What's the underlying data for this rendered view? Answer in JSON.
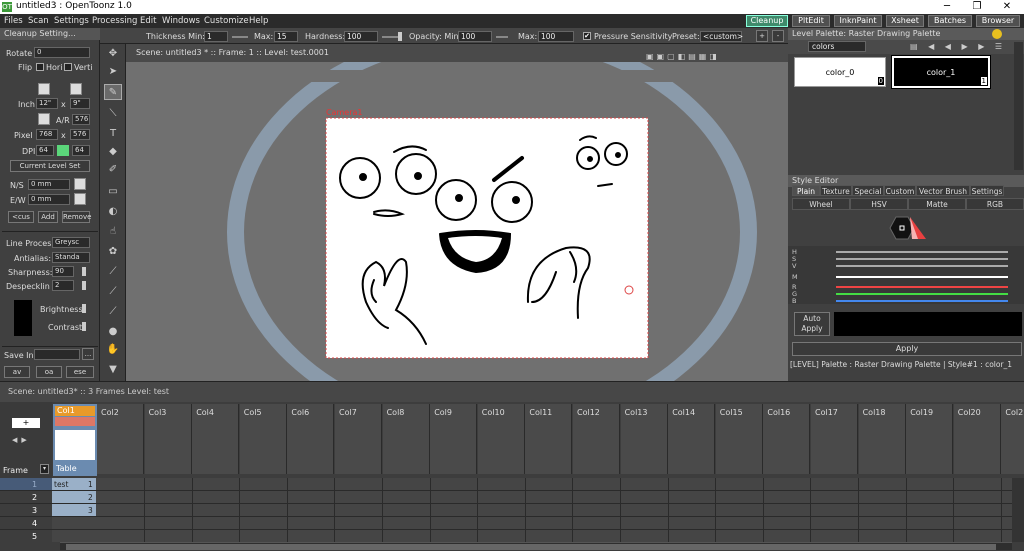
{
  "window": {
    "title": "untitled3 : OpenToonz 1.0",
    "app_icon": "OT"
  },
  "menu": [
    "Files",
    "Scan",
    "Settings",
    "Processing",
    "Edit",
    "Windows",
    "Customize",
    "Help"
  ],
  "rooms": [
    {
      "label": "Cleanup",
      "active": true
    },
    {
      "label": "PltEdit",
      "active": false
    },
    {
      "label": "InknPaint",
      "active": false
    },
    {
      "label": "Xsheet",
      "active": false
    },
    {
      "label": "Batches",
      "active": false
    },
    {
      "label": "Browser",
      "active": false
    }
  ],
  "tool_options": {
    "thickness_min_label": "Thickness Min:",
    "thickness_min": "1",
    "max_label": "Max:",
    "thickness_max": "15",
    "hardness_label": "Hardness:",
    "hardness": "100",
    "opacity_min_label": "Opacity: Min:",
    "opacity_min": "100",
    "opacity_max_label": "Max:",
    "opacity_max": "100",
    "pressure_label": "Pressure Sensitivity",
    "pressure_check": "✔",
    "preset_label": "Preset:",
    "preset": "<custom>",
    "add_preset": "+",
    "remove_preset": "-"
  },
  "cleanup": {
    "header": "Cleanup Setting...",
    "rotate_label": "Rotate",
    "rotate": "0",
    "flip_label": "Flip",
    "hori_label": "Hori",
    "verti_label": "Verti",
    "inch_label": "Inch",
    "inch_w": "12\"",
    "inch_h": "9\"",
    "x1": "x",
    "ar_label": "A/R",
    "ar": "576",
    "pixel_label": "Pixel",
    "pixel_w": "768",
    "pixel_h": "576",
    "x2": "x",
    "dpi_label": "DPI",
    "dpi1": "64",
    "dpi2": "64",
    "current_level": "Current Level Set",
    "ns_label": "N/S",
    "ns": "0 mm",
    "ew_label": "E/W",
    "ew": "0 mm",
    "cus_btn": "<cus",
    "add_btn": "Add",
    "remove_btn": "Remove",
    "line_proc_label": "Line Proces",
    "line_proc": "Greysc",
    "antialias_label": "Antialias:",
    "antialias": "Standa",
    "sharpness_label": "Sharpness:",
    "sharpness": "90",
    "despeckle_label": "Despecklin",
    "despeckle": "2",
    "brightness_label": "Brightness:",
    "contrast_label": "Contrast:",
    "save_in_label": "Save In",
    "browse": "...",
    "btn1": "av",
    "btn2": "oa",
    "btn3": "ese"
  },
  "viewer": {
    "header_scene": "Scene: untitled3 *",
    "sep1": "::",
    "header_frame": "Frame: 1",
    "sep2": "::",
    "header_level": "Level: test.0001",
    "camera_label": "Camera1"
  },
  "palette": {
    "header": "Level Palette: Raster Drawing Palette",
    "page": "colors",
    "styles": [
      {
        "name": "color_0",
        "index": "0"
      },
      {
        "name": "color_1",
        "index": "1"
      }
    ]
  },
  "style_editor": {
    "header": "Style Editor",
    "tabs": [
      "Plain",
      "Texture",
      "Special",
      "Custom",
      "Vector Brush",
      "Settings"
    ],
    "modes": [
      "Wheel",
      "HSV",
      "Matte",
      "RGB"
    ],
    "channels": [
      "H",
      "S",
      "V",
      "M",
      "R",
      "G",
      "B"
    ],
    "auto_apply": "Auto Apply",
    "apply": "Apply",
    "status": "[LEVEL]  Palette : Raster Drawing Palette | Style#1 : color_1"
  },
  "xsheet": {
    "header_scene": "Scene: untitled3*",
    "sep": "::",
    "header_frames": "3 Frames",
    "header_level": "Level: test",
    "col1": "Col1",
    "col1_level": "Table",
    "frame_label": "Frame",
    "columns": [
      "Col2",
      "Col3",
      "Col4",
      "Col5",
      "Col6",
      "Col7",
      "Col8",
      "Col9",
      "Col10",
      "Col11",
      "Col12",
      "Col13",
      "Col14",
      "Col15",
      "Col16",
      "Col17",
      "Col18",
      "Col19",
      "Col20",
      "Col2"
    ],
    "rows": [
      "1",
      "2",
      "3",
      "4",
      "5"
    ],
    "cells": [
      {
        "name": "test",
        "num": "1"
      },
      {
        "name": "",
        "num": "2"
      },
      {
        "name": "",
        "num": "3"
      }
    ]
  },
  "colors": {
    "accent": "#3f8a6b",
    "bg": "#3a3a3a",
    "panel": "#404040",
    "stage_frame": "#8a9aaa"
  }
}
